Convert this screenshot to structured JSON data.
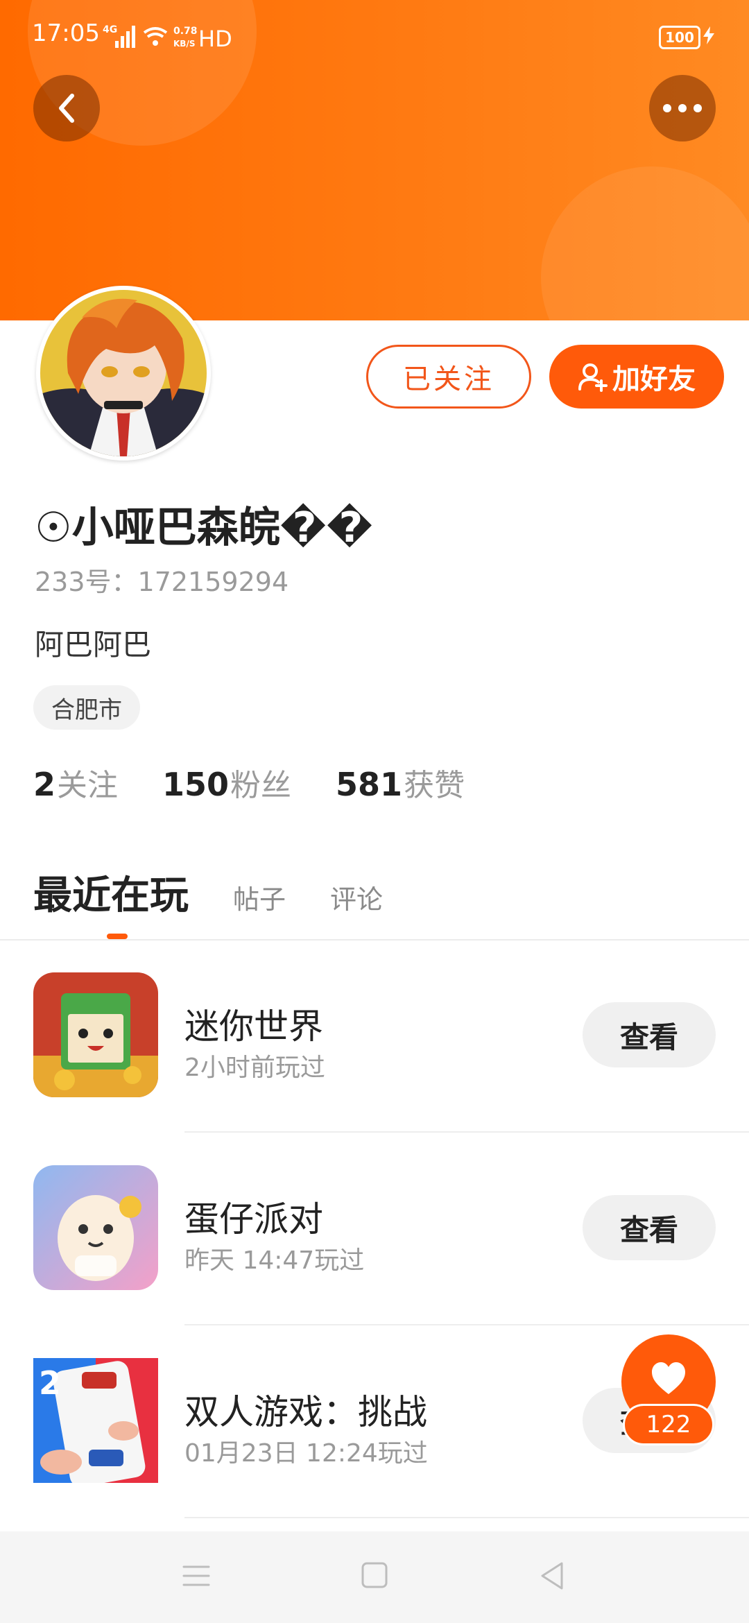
{
  "status_bar": {
    "time": "17:05",
    "network": "4G",
    "speed_value": "0.78",
    "speed_unit": "KB/S",
    "hd": "HD",
    "battery": "100"
  },
  "profile": {
    "nickname": "☉小哑巴森皖��",
    "id_line": "233号：172159294",
    "bio": "阿巴阿巴",
    "location": "合肥市",
    "follow_label": "已关注",
    "add_friend_label": "加好友",
    "stats": {
      "following_count": "2",
      "following_label": "关注",
      "fans_count": "150",
      "fans_label": "粉丝",
      "likes_count": "581",
      "likes_label": "获赞"
    }
  },
  "tabs": {
    "recent": "最近在玩",
    "posts": "帖子",
    "comments": "评论"
  },
  "games": [
    {
      "name": "迷你世界",
      "time": "2小时前玩过",
      "button": "查看",
      "icon": "mini-world-icon"
    },
    {
      "name": "蛋仔派对",
      "time": "昨天 14:47玩过",
      "button": "查看",
      "icon": "eggy-party-icon"
    },
    {
      "name": "双人游戏：挑战",
      "time": "01月23日 12:24玩过",
      "button": "查看",
      "icon": "two-player-game-icon"
    }
  ],
  "like_fab": {
    "count": "122"
  },
  "colors": {
    "accent": "#ff5a0a",
    "header": "#ff7a12"
  }
}
